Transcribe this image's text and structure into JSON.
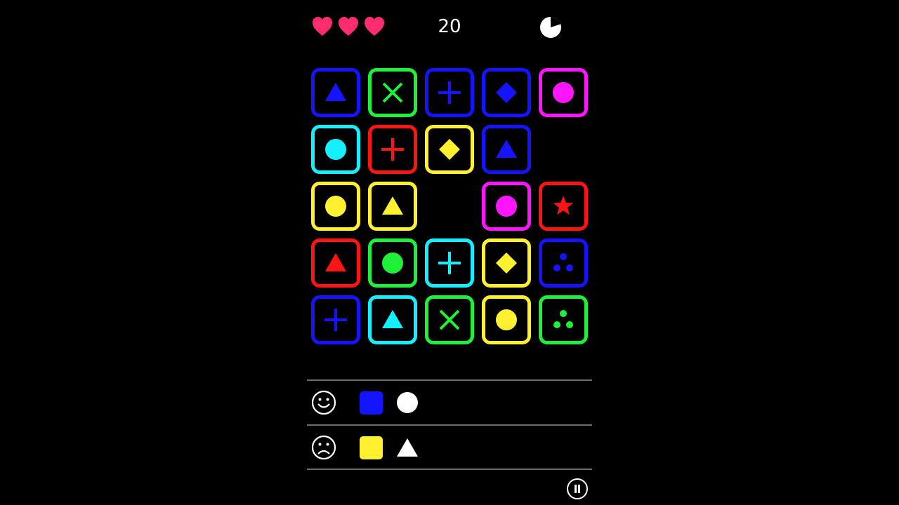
{
  "hud": {
    "lives": 3,
    "score": "20",
    "timer_remaining_fraction": 0.8,
    "heart_color": "#ff2d6f"
  },
  "grid": {
    "rows": 5,
    "cols": 5,
    "tiles": [
      [
        {
          "color": "#1414ff",
          "symbol": "triangle"
        },
        {
          "color": "#1ff03a",
          "symbol": "x"
        },
        {
          "color": "#1414ff",
          "symbol": "plus"
        },
        {
          "color": "#1414ff",
          "symbol": "diamond"
        },
        {
          "color": "#ff16ff",
          "symbol": "circle"
        }
      ],
      [
        {
          "color": "#14f0ff",
          "symbol": "circle"
        },
        {
          "color": "#ff1414",
          "symbol": "plus"
        },
        {
          "color": "#fff030",
          "symbol": "diamond"
        },
        {
          "color": "#1414ff",
          "symbol": "triangle"
        },
        null
      ],
      [
        {
          "color": "#fff030",
          "symbol": "circle"
        },
        {
          "color": "#fff030",
          "symbol": "triangle"
        },
        null,
        {
          "color": "#ff16ff",
          "symbol": "circle"
        },
        {
          "color": "#ff1414",
          "symbol": "star"
        }
      ],
      [
        {
          "color": "#ff1414",
          "symbol": "triangle"
        },
        {
          "color": "#1ff03a",
          "symbol": "circle"
        },
        {
          "color": "#14f0ff",
          "symbol": "plus"
        },
        {
          "color": "#fff030",
          "symbol": "diamond"
        },
        {
          "color": "#1414ff",
          "symbol": "three-dots"
        }
      ],
      [
        {
          "color": "#1414ff",
          "symbol": "plus"
        },
        {
          "color": "#14f0ff",
          "symbol": "triangle"
        },
        {
          "color": "#1ff03a",
          "symbol": "x"
        },
        {
          "color": "#fff030",
          "symbol": "circle"
        },
        {
          "color": "#1ff03a",
          "symbol": "three-dots"
        }
      ]
    ]
  },
  "rules": [
    {
      "mood": "happy",
      "icon": "smiley-icon",
      "color": "#1414ff",
      "shape": "circle"
    },
    {
      "mood": "sad",
      "icon": "frowny-icon",
      "color": "#fff030",
      "shape": "triangle"
    }
  ],
  "controls": {
    "pause_icon": "pause-icon"
  }
}
